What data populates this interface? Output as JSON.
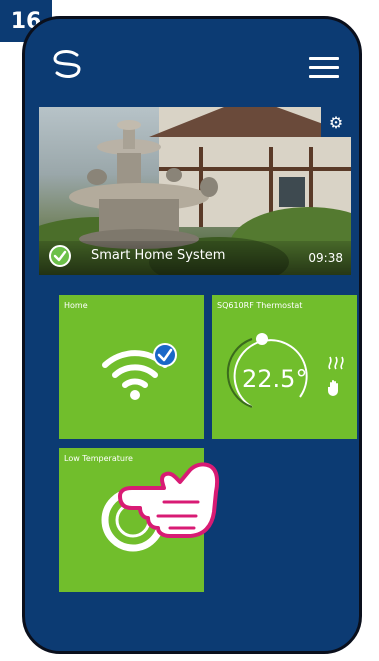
{
  "step_number": "16",
  "colors": {
    "phone_bg": "#0c3b73",
    "tile_green": "#71be2c",
    "hand_outline": "#d81b74",
    "check_green": "#6cc04a"
  },
  "header": {
    "logo_icon": "salus-s-logo",
    "menu_icon": "hamburger-menu"
  },
  "hero": {
    "title": "Smart Home System",
    "time": "09:38",
    "settings_icon": "gear-icon"
  },
  "tiles": [
    {
      "label": "Home",
      "icon": "wifi-icon",
      "status_icon": "check-badge"
    },
    {
      "label": "SQ610RF Thermostat",
      "temperature": "22.5°",
      "icons": [
        "heating-waves-icon",
        "manual-hand-icon"
      ]
    },
    {
      "label": "Low Temperature",
      "icon": "ring-button-icon"
    }
  ]
}
